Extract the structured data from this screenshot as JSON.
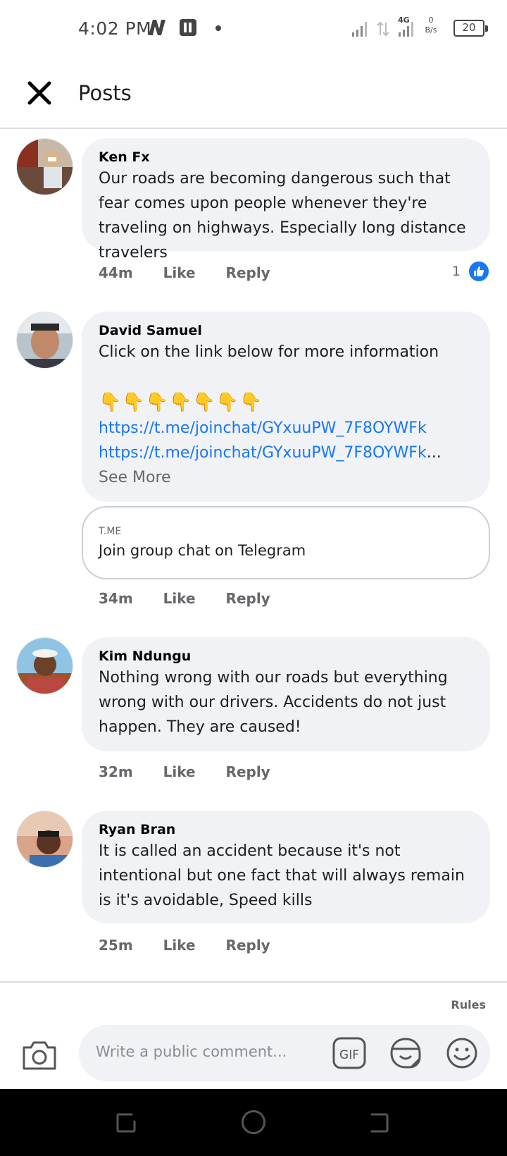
{
  "status_bar": {
    "time": "4:02 PM",
    "network": "4G",
    "speed_value": "0",
    "speed_unit": "B/s",
    "battery": "20"
  },
  "header": {
    "title": "Posts"
  },
  "comments": [
    {
      "author": "Ken Fx",
      "text": "Our roads are becoming dangerous such that fear comes upon people whenever they're traveling on highways. Especially long distance travelers",
      "time": "44m",
      "like_label": "Like",
      "reply_label": "Reply",
      "like_count": "1"
    },
    {
      "author": "David Samuel",
      "text": "Click on the link below for more information",
      "emojis": "👇👇👇👇👇👇👇",
      "link1": "https://t.me/joinchat/GYxuuPW_7F8OYWFk",
      "link2": "https://t.me/joinchat/GYxuuPW_7F8OYWFk",
      "ellipsis": "...",
      "see_more": "See More",
      "card_domain": "T.ME",
      "card_title": "Join group chat on Telegram",
      "time": "34m",
      "like_label": "Like",
      "reply_label": "Reply"
    },
    {
      "author": "Kim Ndungu",
      "text": "Nothing wrong with our roads but everything wrong with our drivers. Accidents do not just happen. They are caused!",
      "time": "32m",
      "like_label": "Like",
      "reply_label": "Reply"
    },
    {
      "author": "Ryan Bran",
      "text": "It is called an accident because it's not intentional but one fact that will always remain is it's avoidable, Speed kills",
      "time": "25m",
      "like_label": "Like",
      "reply_label": "Reply"
    }
  ],
  "composer": {
    "rules_label": "Rules",
    "placeholder": "Write a public comment...",
    "gif_label": "GIF"
  },
  "colors": {
    "accent": "#1877f2",
    "bubble": "#f0f2f5",
    "meta_text": "#65676b"
  },
  "icons": [
    "close-icon",
    "camera-icon",
    "gif-icon",
    "sticker-icon",
    "emoji-icon",
    "like-thumb-icon"
  ]
}
